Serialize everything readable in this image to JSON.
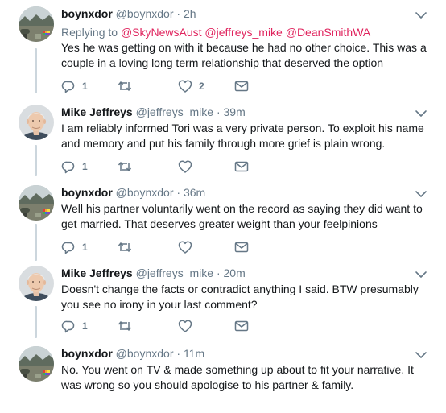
{
  "tweets": [
    {
      "name": "boynxdor",
      "handle": "@boynxdor",
      "sep": "·",
      "time": "2h",
      "avatar": "landscape-rainbow-avatar",
      "replying_prefix": "Replying to",
      "mentions": [
        "@SkyNewsAust",
        "@jeffreys_mike",
        "@DeanSmithWA"
      ],
      "text": "Yes he was getting on with it because he had no other choice. This was a couple in a loving long term relationship that deserved the option",
      "reply_count": "1",
      "retweet_count": "",
      "like_count": "2"
    },
    {
      "name": "Mike Jeffreys",
      "handle": "@jeffreys_mike",
      "sep": "·",
      "time": "39m",
      "avatar": "grey-haired-man-avatar",
      "text": "I am reliably informed Tori was a very private person. To exploit his name and memory and put his family through more grief is plain wrong.",
      "reply_count": "1",
      "retweet_count": "",
      "like_count": ""
    },
    {
      "name": "boynxdor",
      "handle": "@boynxdor",
      "sep": "·",
      "time": "36m",
      "avatar": "landscape-rainbow-avatar",
      "text": "Well his partner voluntarily went on the record as saying they did want to get married. That deserves greater weight than your feelpinions",
      "reply_count": "1",
      "retweet_count": "",
      "like_count": ""
    },
    {
      "name": "Mike Jeffreys",
      "handle": "@jeffreys_mike",
      "sep": "·",
      "time": "20m",
      "avatar": "grey-haired-man-avatar",
      "text": "Doesn't change the facts or contradict anything I said. BTW presumably you see no irony in your last comment?",
      "reply_count": "1",
      "retweet_count": "",
      "like_count": ""
    },
    {
      "name": "boynxdor",
      "handle": "@boynxdor",
      "sep": "·",
      "time": "11m",
      "avatar": "landscape-rainbow-avatar",
      "text": "No. You went on TV & made something up about to fit your narrative. It was wrong so you should apologise to his partner & family."
    }
  ],
  "colors": {
    "text": "#14171a",
    "secondary": "#657786",
    "mention": "#e0245e",
    "thread_line": "#ccd6dd"
  }
}
